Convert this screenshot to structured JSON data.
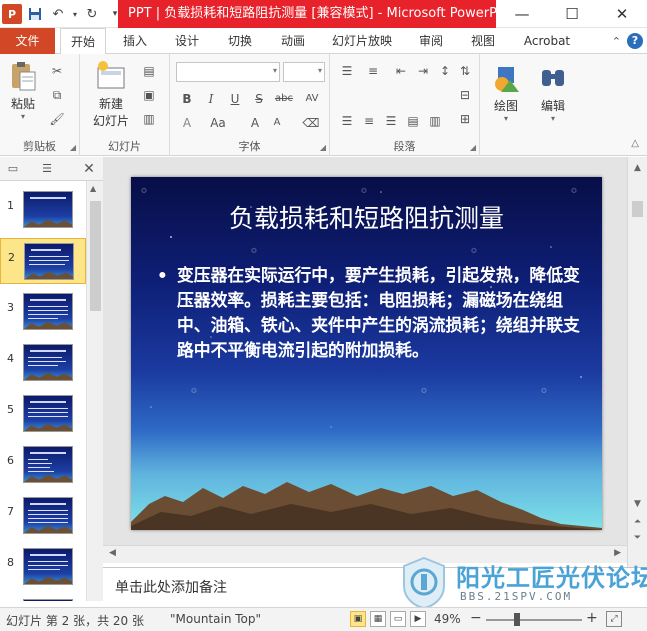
{
  "window": {
    "title": "PPT | 负载损耗和短路阻抗测量 [兼容模式] - Microsoft PowerP...",
    "app_icon": "P"
  },
  "tabs": {
    "file": "文件",
    "items": [
      "开始",
      "插入",
      "设计",
      "切换",
      "动画",
      "幻灯片放映",
      "审阅",
      "视图",
      "Acrobat"
    ]
  },
  "ribbon": {
    "clipboard": {
      "label": "剪贴板",
      "paste": "粘贴"
    },
    "slides": {
      "label": "幻灯片",
      "new_slide_line1": "新建",
      "new_slide_line2": "幻灯片"
    },
    "font": {
      "label": "字体",
      "bold": "B",
      "italic": "I",
      "underline": "U",
      "strike": "S",
      "abc": "abc",
      "av": "AV",
      "aa": "Aa",
      "color": "A",
      "grow": "A",
      "shrink": "A"
    },
    "paragraph": {
      "label": "段落"
    },
    "drawing": {
      "label": "绘图"
    },
    "editing": {
      "label": "编辑"
    }
  },
  "thumbnails": {
    "numbers": [
      "1",
      "2",
      "3",
      "4",
      "5",
      "6",
      "7",
      "8"
    ],
    "selected": 2
  },
  "slide": {
    "title": "负载损耗和短路阻抗测量",
    "bullet": "•",
    "body": "变压器在实际运行中，要产生损耗，引起发热，降低变压器效率。损耗主要包括：电阻损耗；漏磁场在绕组中、油箱、铁心、夹件中产生的涡流损耗；绕组并联支路中不平衡电流引起的附加损耗。"
  },
  "notes": {
    "placeholder": "单击此处添加备注"
  },
  "status": {
    "slide_info": "幻灯片 第 2 张，共 20 张",
    "theme": "\"Mountain Top\"",
    "zoom": "49%",
    "zoom_minus": "−",
    "zoom_plus": "+"
  },
  "watermark": {
    "brand": "阳光工匠光伏论坛",
    "url": "BBS.21SPV.COM"
  },
  "colors": {
    "title_bar_accent": "#e8222a",
    "file_tab": "#d24726",
    "selection": "#fde58a"
  }
}
